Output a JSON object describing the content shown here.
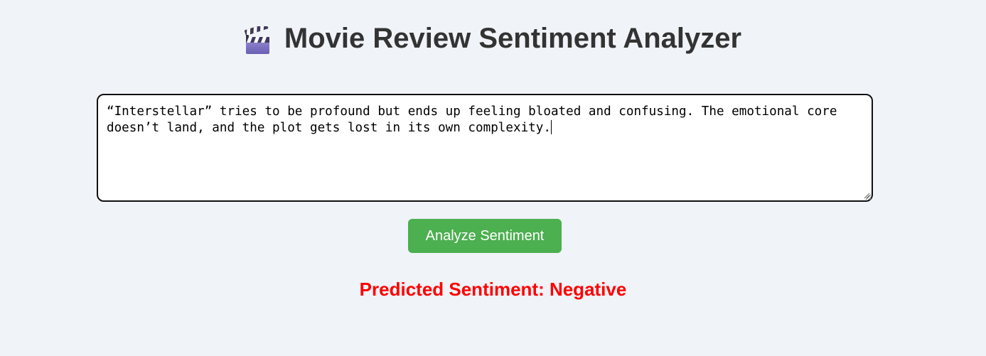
{
  "header": {
    "icon": "clapperboard-icon",
    "title": "Movie Review Sentiment Analyzer"
  },
  "review": {
    "value": "“Interstellar” tries to be profound but ends up feeling bloated and confusing. The emotional core doesn’t land, and the plot gets lost in its own complexity."
  },
  "analyze_button": {
    "label": "Analyze Sentiment"
  },
  "result": {
    "text": "Predicted Sentiment: Negative"
  },
  "colors": {
    "background": "#f0f3f8",
    "button": "#4caf50",
    "result_negative": "#ff0000",
    "title": "#333333"
  }
}
